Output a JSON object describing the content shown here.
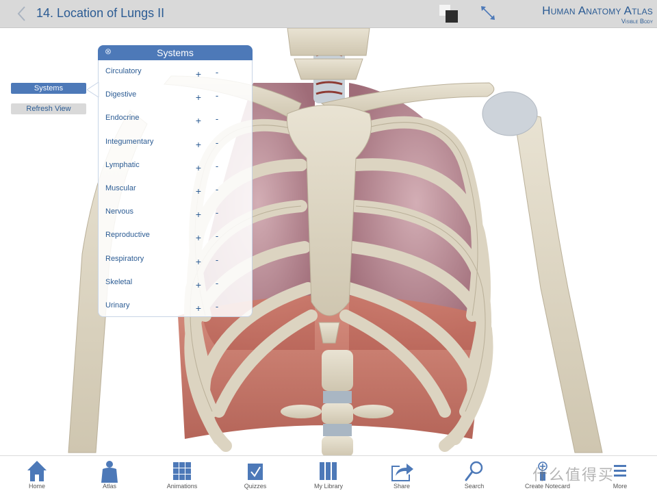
{
  "header": {
    "back_icon": "chevron-left-icon",
    "title": "14. Location of Lungs II",
    "view_toggle_icon": "layers-toggle-icon",
    "expand_icon": "expand-arrows-icon",
    "brand_title": "Human Anatomy Atlas",
    "brand_sub": "Visible Body"
  },
  "side_buttons": {
    "systems": "Systems",
    "refresh": "Refresh View"
  },
  "systems_panel": {
    "title": "Systems",
    "close_icon": "⊗",
    "plus": "+",
    "minus": "-",
    "items": [
      {
        "label": "Circulatory"
      },
      {
        "label": "Digestive"
      },
      {
        "label": "Endocrine"
      },
      {
        "label": "Integumentary"
      },
      {
        "label": "Lymphatic"
      },
      {
        "label": "Muscular"
      },
      {
        "label": "Nervous"
      },
      {
        "label": "Reproductive"
      },
      {
        "label": "Respiratory"
      },
      {
        "label": "Skeletal"
      },
      {
        "label": "Urinary"
      }
    ]
  },
  "tabbar": {
    "items": [
      {
        "label": "Home",
        "icon": "home-icon"
      },
      {
        "label": "Atlas",
        "icon": "body-icon"
      },
      {
        "label": "Animations",
        "icon": "grid-icon"
      },
      {
        "label": "Quizzes",
        "icon": "checkbox-icon"
      },
      {
        "label": "My Library",
        "icon": "books-icon"
      },
      {
        "label": "Share",
        "icon": "share-icon"
      },
      {
        "label": "Search",
        "icon": "search-icon"
      },
      {
        "label": "Create Notecard",
        "icon": "notecard-icon"
      },
      {
        "label": "More",
        "icon": "more-icon"
      }
    ]
  },
  "watermark": "什么值得买",
  "colors": {
    "accent": "#4d79b8",
    "text_blue": "#2b5b93",
    "topbar_bg": "#d9d9d9",
    "bone": "#ddd6c4",
    "lung": "#b98a94",
    "muscle": "#c0604f"
  }
}
